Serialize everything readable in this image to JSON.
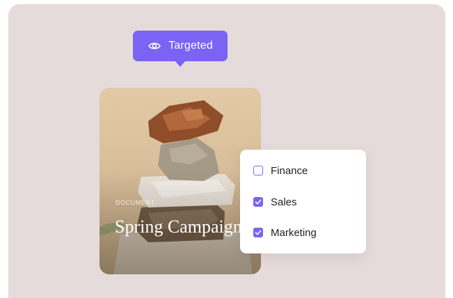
{
  "tooltip": {
    "label": "Targeted",
    "icon": "eye-icon"
  },
  "card": {
    "category": "DOCUMENT",
    "title": "Spring Campaign"
  },
  "filter": {
    "options": [
      {
        "label": "Finance",
        "checked": false
      },
      {
        "label": "Sales",
        "checked": true
      },
      {
        "label": "Marketing",
        "checked": true
      }
    ]
  },
  "colors": {
    "accent": "#7b63f4",
    "background": "#e6dbdb"
  }
}
